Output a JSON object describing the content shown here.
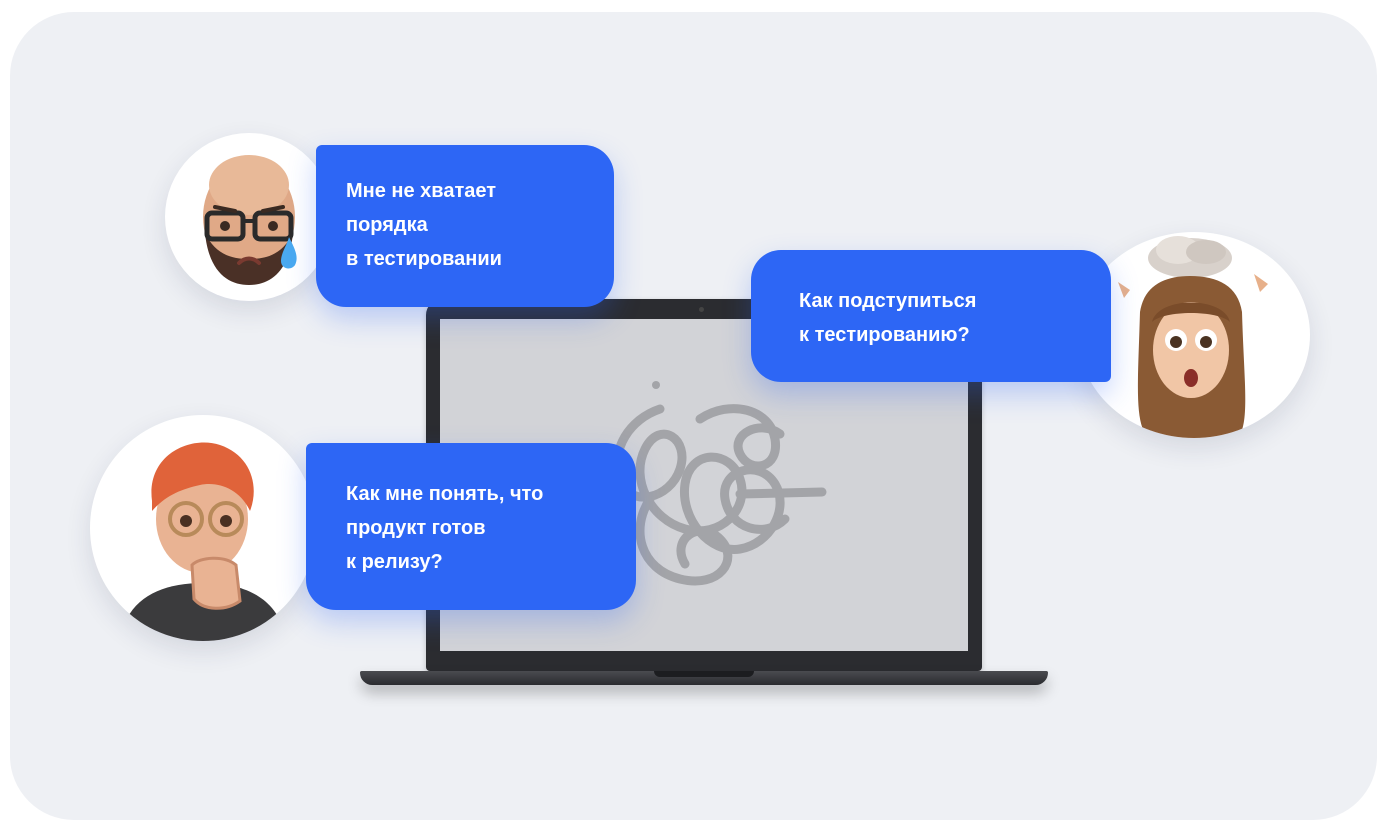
{
  "bubbles": {
    "top_left": {
      "lines": [
        "Мне не хватает",
        "порядка",
        "в тестировании"
      ]
    },
    "right": {
      "lines": [
        "Как подступиться",
        "к тестированию?"
      ]
    },
    "bottom_left": {
      "lines": [
        "Как мне понять, что",
        "продукт готов",
        "к релизу?"
      ]
    }
  },
  "avatars": {
    "top_left": "bald-man-crying-avatar",
    "right": "mind-blown-woman-avatar",
    "bottom_left": "nervous-redhead-avatar"
  },
  "colors": {
    "background": "#eef0f4",
    "bubble": "#2d66f5",
    "laptop": "#2b2c30",
    "screen": "#d2d3d7"
  }
}
